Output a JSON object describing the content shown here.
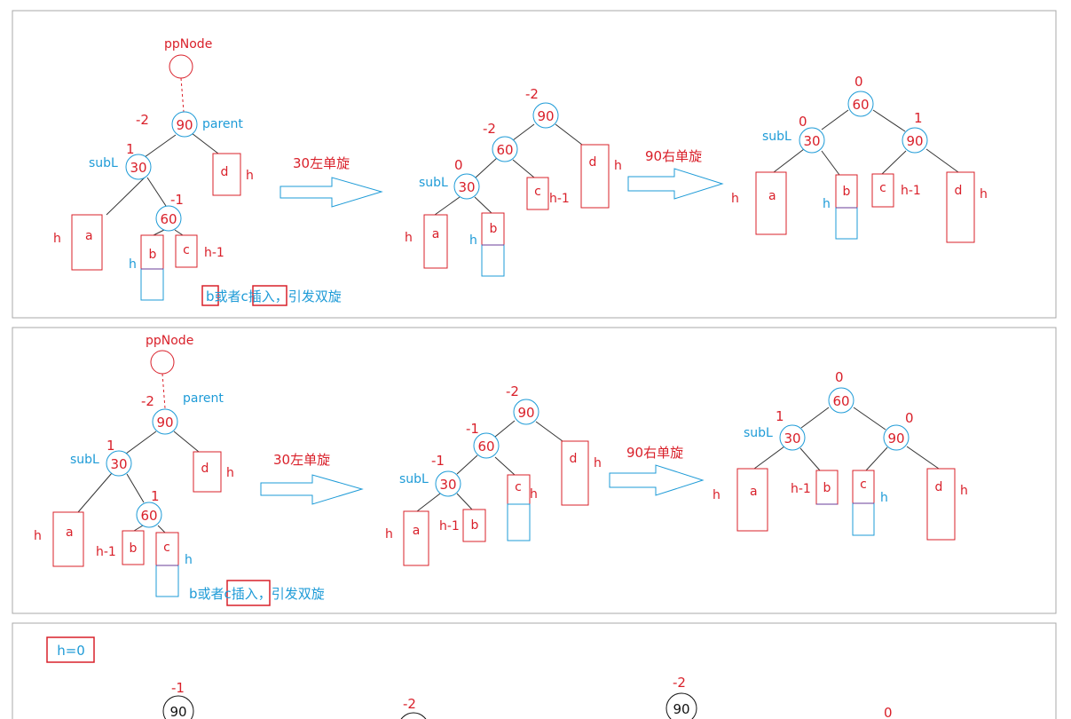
{
  "panel1": {
    "ppnode": "ppNode",
    "parent": "parent",
    "subl": "subL",
    "bf_90": "-2",
    "bf_30": "1",
    "bf_60": "-1",
    "n90": "90",
    "n30": "30",
    "n60": "60",
    "a": "a",
    "b": "b",
    "c": "c",
    "d": "d",
    "h": "h",
    "hm1": "h-1",
    "arrow1": "30左单旋",
    "arrow2": "90右单旋",
    "s2_bf_90": "-2",
    "s2_bf_60": "-2",
    "s2_bf_30": "0",
    "s3_bf_60": "0",
    "s3_bf_30": "0",
    "s3_bf_90": "1",
    "note_b": "b",
    "note_mid": "或者c",
    "note_ins": "插入",
    "note_tail": "，引发双旋"
  },
  "panel2": {
    "ppnode": "ppNode",
    "parent": "parent",
    "subl": "subL",
    "bf_90": "-2",
    "bf_30": "1",
    "bf_60": "1",
    "arrow1": "30左单旋",
    "arrow2": "90右单旋",
    "s2_bf_90": "-2",
    "s2_bf_60": "-1",
    "s2_bf_30": "-1",
    "s3_bf_60": "0",
    "s3_bf_30": "1",
    "s3_bf_90": "0",
    "note_start": "b或者",
    "note_c": "c",
    "note_ins": "插入",
    "note_tail": "，引发双旋"
  },
  "panel3": {
    "h0": "h=0",
    "bf1": "-1",
    "n1": "90",
    "bf2": "-2",
    "bf3": "-2",
    "n3": "90",
    "bf4": "0"
  }
}
